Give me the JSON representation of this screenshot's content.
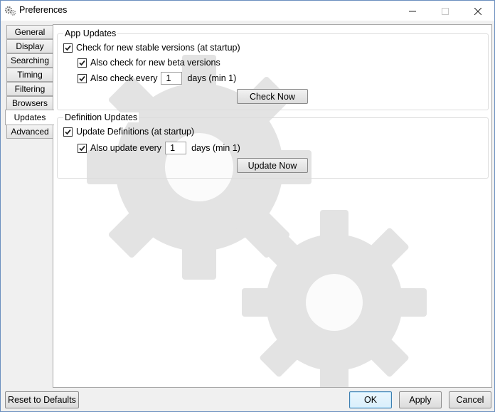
{
  "window": {
    "title": "Preferences",
    "icon": "gears-icon",
    "controls": {
      "minimize": "minimize-icon",
      "maximize": "maximize-icon",
      "close": "close-icon"
    }
  },
  "tabs": [
    {
      "label": "General"
    },
    {
      "label": "Display"
    },
    {
      "label": "Searching"
    },
    {
      "label": "Timing"
    },
    {
      "label": "Filtering"
    },
    {
      "label": "Browsers"
    },
    {
      "label": "Updates",
      "active": true
    },
    {
      "label": "Advanced"
    }
  ],
  "app_updates": {
    "title": "App Updates",
    "check_stable": {
      "label": "Check for new stable versions (at startup)",
      "checked": true
    },
    "check_beta": {
      "label": "Also check for new beta versions",
      "checked": true
    },
    "check_every": {
      "label": "Also check every",
      "value": "1",
      "suffix": "days (min 1)",
      "checked": true
    },
    "check_now_label": "Check Now"
  },
  "definition_updates": {
    "title": "Definition Updates",
    "update_definitions": {
      "label": "Update Definitions (at startup)",
      "checked": true
    },
    "update_every": {
      "label": "Also update every",
      "value": "1",
      "suffix": "days (min 1)",
      "checked": true
    },
    "update_now_label": "Update Now"
  },
  "footer": {
    "reset_label": "Reset to Defaults",
    "ok_label": "OK",
    "apply_label": "Apply",
    "cancel_label": "Cancel"
  },
  "colors": {
    "accent": "#3c7fb1",
    "window_border": "#6b8fbf",
    "background": "#f0f0f0"
  }
}
